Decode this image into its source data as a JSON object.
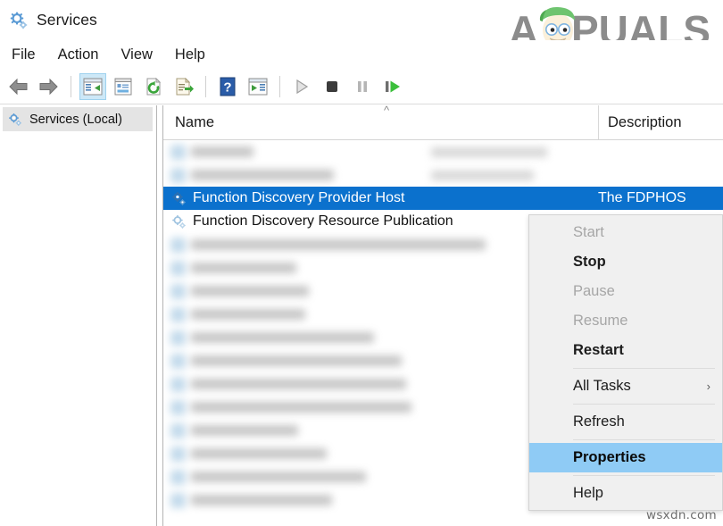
{
  "window": {
    "title": "Services",
    "title_icon": "gear-icon"
  },
  "brand": {
    "text_left": "A",
    "text_right": "PUALS",
    "name": "appuals-logo"
  },
  "menubar": {
    "items": [
      {
        "label": "File"
      },
      {
        "label": "Action"
      },
      {
        "label": "View"
      },
      {
        "label": "Help"
      }
    ]
  },
  "toolbar": {
    "buttons": [
      {
        "name": "back-icon",
        "glyph": "←",
        "enabled": true
      },
      {
        "name": "forward-icon",
        "glyph": "→",
        "enabled": true
      },
      {
        "name": "show-hide-console-tree-icon",
        "glyph": "",
        "enabled": true,
        "active": true
      },
      {
        "name": "properties-icon",
        "glyph": "",
        "enabled": true
      },
      {
        "name": "refresh-icon",
        "glyph": "",
        "enabled": true
      },
      {
        "name": "export-list-icon",
        "glyph": "",
        "enabled": true
      },
      {
        "name": "help-icon",
        "glyph": "?",
        "enabled": true
      },
      {
        "name": "show-action-pane-icon",
        "glyph": "",
        "enabled": true
      },
      {
        "name": "start-service-icon",
        "glyph": "▶",
        "enabled": false
      },
      {
        "name": "stop-service-icon",
        "glyph": "■",
        "enabled": true
      },
      {
        "name": "pause-service-icon",
        "glyph": "▐▌",
        "enabled": false
      },
      {
        "name": "restart-service-icon",
        "glyph": "▶",
        "enabled": true
      }
    ]
  },
  "sidebar": {
    "items": [
      {
        "label": "Services (Local)",
        "icon": "gear-icon",
        "selected": true
      }
    ]
  },
  "list": {
    "columns": [
      {
        "key": "name",
        "label": "Name",
        "sorted": true,
        "sort_dir": "asc"
      },
      {
        "key": "description",
        "label": "Description"
      }
    ],
    "rows": [
      {
        "name": "",
        "description": "",
        "blurred": true,
        "selected": false
      },
      {
        "name": "",
        "description": "",
        "blurred": true,
        "selected": false
      },
      {
        "name": "Function Discovery Provider Host",
        "description": "The FDPHOS",
        "blurred": false,
        "selected": true
      },
      {
        "name": "Function Discovery Resource Publication",
        "description": "",
        "blurred": false,
        "selected": false
      },
      {
        "name": "",
        "description": "",
        "blurred": true,
        "selected": false
      },
      {
        "name": "",
        "description": "",
        "blurred": true,
        "selected": false
      },
      {
        "name": "",
        "description": "",
        "blurred": true,
        "selected": false
      },
      {
        "name": "",
        "description": "",
        "blurred": true,
        "selected": false
      },
      {
        "name": "",
        "description": "",
        "blurred": true,
        "selected": false
      },
      {
        "name": "",
        "description": "",
        "blurred": true,
        "selected": false
      },
      {
        "name": "",
        "description": "",
        "blurred": true,
        "selected": false
      },
      {
        "name": "",
        "description": "",
        "blurred": true,
        "selected": false
      },
      {
        "name": "",
        "description": "",
        "blurred": true,
        "selected": false
      },
      {
        "name": "",
        "description": "",
        "blurred": true,
        "selected": false
      },
      {
        "name": "",
        "description": "",
        "blurred": true,
        "selected": false
      },
      {
        "name": "",
        "description": "",
        "blurred": true,
        "selected": false
      }
    ]
  },
  "context_menu": {
    "items": [
      {
        "label": "Start",
        "enabled": false,
        "bold": false,
        "highlight": false,
        "submenu": false
      },
      {
        "label": "Stop",
        "enabled": true,
        "bold": true,
        "highlight": false,
        "submenu": false
      },
      {
        "label": "Pause",
        "enabled": false,
        "bold": false,
        "highlight": false,
        "submenu": false
      },
      {
        "label": "Resume",
        "enabled": false,
        "bold": false,
        "highlight": false,
        "submenu": false
      },
      {
        "label": "Restart",
        "enabled": true,
        "bold": true,
        "highlight": false,
        "submenu": false
      },
      {
        "separator": true
      },
      {
        "label": "All Tasks",
        "enabled": true,
        "bold": false,
        "highlight": false,
        "submenu": true,
        "arrow": "›"
      },
      {
        "separator": true
      },
      {
        "label": "Refresh",
        "enabled": true,
        "bold": false,
        "highlight": false,
        "submenu": false
      },
      {
        "separator": true
      },
      {
        "label": "Properties",
        "enabled": true,
        "bold": true,
        "highlight": true,
        "submenu": false
      },
      {
        "separator": true
      },
      {
        "label": "Help",
        "enabled": true,
        "bold": false,
        "highlight": false,
        "submenu": false
      }
    ]
  },
  "watermark": {
    "text": "wsxdn.com"
  },
  "colors": {
    "selection_blue": "#0b71cd",
    "menu_highlight": "#8fcbf5",
    "toolbar_active": "#cde8f7",
    "brand_gray": "#8c8c8c",
    "brand_green": "#66c172"
  }
}
